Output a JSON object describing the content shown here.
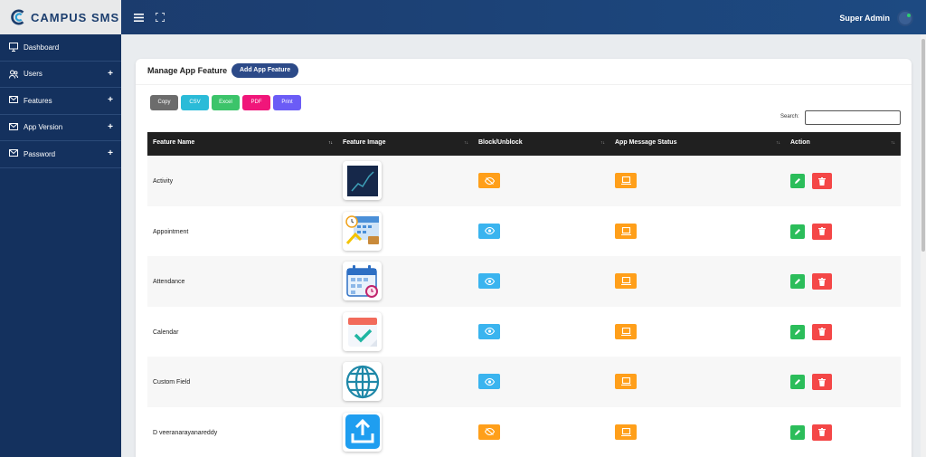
{
  "brand": {
    "name": "CAMPUS SMS",
    "logo_icon": "campus-logo-icon"
  },
  "topbar": {
    "menu_icon": "hamburger-icon",
    "fullscreen_icon": "fullscreen-icon",
    "user": "Super Admin",
    "avatar_status_color": "#2ecc71"
  },
  "sidebar": {
    "items": [
      {
        "label": "Dashboard",
        "icon": "monitor-icon",
        "expandable": false
      },
      {
        "label": "Users",
        "icon": "users-icon",
        "expandable": true
      },
      {
        "label": "Features",
        "icon": "mail-icon",
        "expandable": true
      },
      {
        "label": "App Version",
        "icon": "mail-icon",
        "expandable": true
      },
      {
        "label": "Password",
        "icon": "mail-icon",
        "expandable": true
      }
    ],
    "expand_symbol": "+"
  },
  "card": {
    "title": "Manage App Feature",
    "add_button": "Add App Feature"
  },
  "export_buttons": [
    {
      "label": "Copy",
      "color": "#6c6c6c"
    },
    {
      "label": "CSV",
      "color": "#2bbbd8"
    },
    {
      "label": "Excel",
      "color": "#3cc46a"
    },
    {
      "label": "PDF",
      "color": "#f0167a"
    },
    {
      "label": "Print",
      "color": "#6b5cf6"
    }
  ],
  "search": {
    "label": "Search:",
    "value": ""
  },
  "table": {
    "columns": [
      "Feature Name",
      "Feature Image",
      "Block/Unblock",
      "App Message Status",
      "Action"
    ],
    "sort_glyph": "↑↓",
    "rows": [
      {
        "name": "Activity",
        "image": "chart-icon",
        "block_state": "hidden",
        "block_color": "orange"
      },
      {
        "name": "Appointment",
        "image": "appointment-calendar-icon",
        "block_state": "visible",
        "block_color": "blue"
      },
      {
        "name": "Attendance",
        "image": "attendance-calendar-icon",
        "block_state": "visible",
        "block_color": "blue"
      },
      {
        "name": "Calendar",
        "image": "calendar-check-icon",
        "block_state": "visible",
        "block_color": "blue"
      },
      {
        "name": "Custom Field",
        "image": "globe-icon",
        "block_state": "visible",
        "block_color": "blue"
      },
      {
        "name": "D veeranarayanareddy",
        "image": "upload-icon",
        "block_state": "hidden",
        "block_color": "orange"
      }
    ]
  },
  "colors": {
    "topbar": "#1b3a6b",
    "sidebar": "#14315e",
    "orange": "#ff9f1a",
    "blue": "#3ab4ef",
    "green": "#2bbd5a",
    "red": "#f44747"
  }
}
